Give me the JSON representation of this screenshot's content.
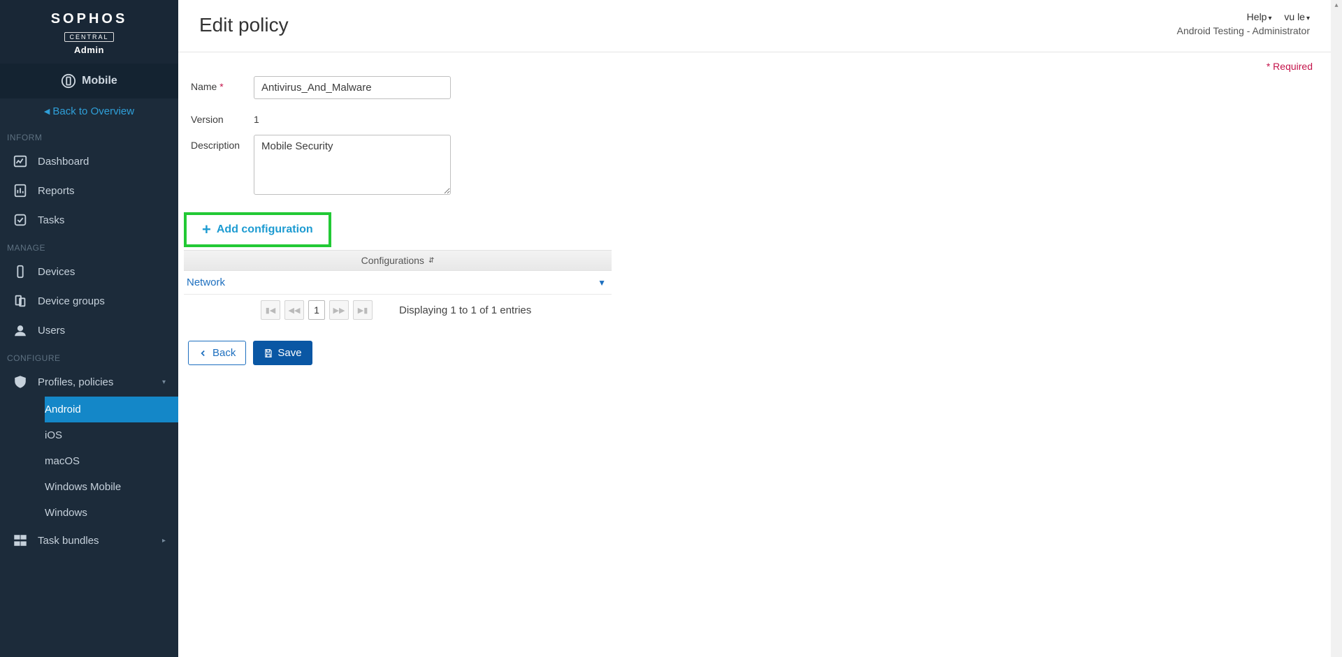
{
  "brand": {
    "name": "SOPHOS",
    "tag": "CENTRAL",
    "role": "Admin"
  },
  "context": {
    "section": "Mobile",
    "back": "Back to Overview"
  },
  "sidebar": {
    "sections": {
      "inform": {
        "title": "INFORM",
        "items": [
          {
            "label": "Dashboard"
          },
          {
            "label": "Reports"
          },
          {
            "label": "Tasks"
          }
        ]
      },
      "manage": {
        "title": "MANAGE",
        "items": [
          {
            "label": "Devices"
          },
          {
            "label": "Device groups"
          },
          {
            "label": "Users"
          }
        ]
      },
      "configure": {
        "title": "CONFIGURE",
        "profiles": {
          "label": "Profiles, policies",
          "children": [
            {
              "label": "Android"
            },
            {
              "label": "iOS"
            },
            {
              "label": "macOS"
            },
            {
              "label": "Windows Mobile"
            },
            {
              "label": "Windows"
            }
          ]
        },
        "task_bundles": {
          "label": "Task bundles"
        }
      }
    }
  },
  "header": {
    "title": "Edit policy",
    "help": "Help",
    "user": "vu le",
    "subtitle": "Android Testing - Administrator",
    "required": "* Required"
  },
  "form": {
    "name_label": "Name",
    "name_value": "Antivirus_And_Malware",
    "version_label": "Version",
    "version_value": "1",
    "description_label": "Description",
    "description_value": "Mobile Security"
  },
  "configurations": {
    "add_label": "Add configuration",
    "col_header": "Configurations",
    "rows": [
      {
        "label": "Network"
      }
    ],
    "pager": {
      "current": "1",
      "info": "Displaying 1 to 1 of 1 entries"
    }
  },
  "actions": {
    "back": "Back",
    "save": "Save"
  }
}
